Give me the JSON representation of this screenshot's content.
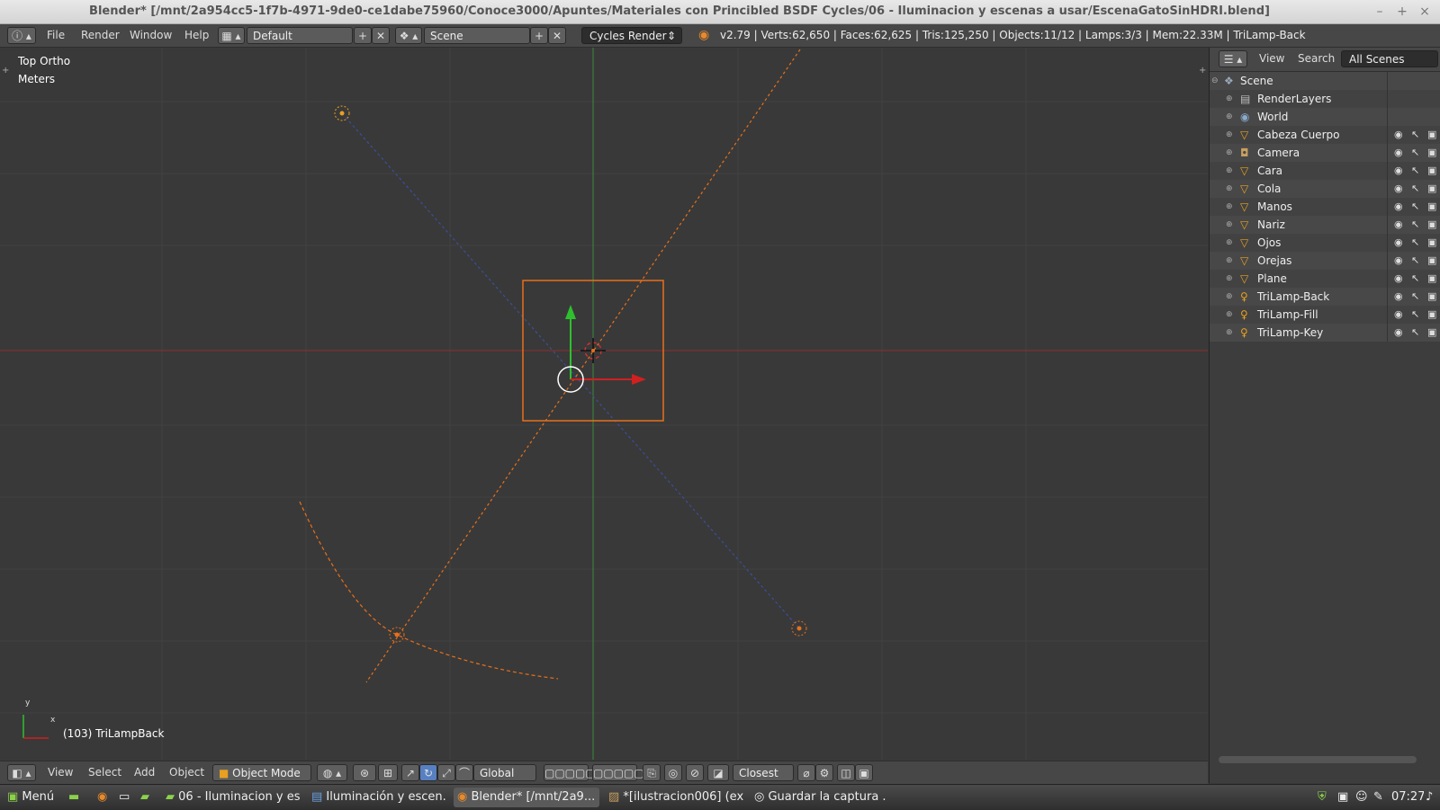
{
  "window": {
    "title": "Blender* [/mnt/2a954cc5-1f7b-4971-9de0-ce1dabe75960/Conoce3000/Apuntes/Materiales con Princibled BSDF Cycles/06 - Iluminacion y escenas a usar/EscenaGatoSinHDRI.blend]",
    "minimize": "–",
    "maximize": "+",
    "close": "×"
  },
  "infobar": {
    "menus": [
      "File",
      "Render",
      "Window",
      "Help"
    ],
    "layout": "Default",
    "scene": "Scene",
    "engine": "Cycles Render",
    "stats": "v2.79 | Verts:62,650 | Faces:62,625 | Tris:125,250 | Objects:11/12 | Lamps:3/3 | Mem:22.33M | TriLamp-Back"
  },
  "viewport": {
    "view_name": "Top Ortho",
    "units": "Meters",
    "active_object": "(103) TriLampBack",
    "axis_y": "y",
    "axis_x": "x"
  },
  "outliner": {
    "view_menu": "View",
    "search_menu": "Search",
    "display_mode": "All Scenes",
    "rows": [
      {
        "name": "Scene",
        "type": "scene"
      },
      {
        "name": "RenderLayers",
        "type": "renderlayers"
      },
      {
        "name": "World",
        "type": "world"
      },
      {
        "name": "Cabeza Cuerpo",
        "type": "mesh"
      },
      {
        "name": "Camera",
        "type": "camera"
      },
      {
        "name": "Cara",
        "type": "mesh"
      },
      {
        "name": "Cola",
        "type": "mesh"
      },
      {
        "name": "Manos",
        "type": "mesh"
      },
      {
        "name": "Nariz",
        "type": "mesh"
      },
      {
        "name": "Ojos",
        "type": "mesh"
      },
      {
        "name": "Orejas",
        "type": "mesh"
      },
      {
        "name": "Plane",
        "type": "mesh"
      },
      {
        "name": "TriLamp-Back",
        "type": "lamp"
      },
      {
        "name": "TriLamp-Fill",
        "type": "lamp"
      },
      {
        "name": "TriLamp-Key",
        "type": "lamp"
      }
    ]
  },
  "bottombar": {
    "menus": [
      "View",
      "Select",
      "Add",
      "Object"
    ],
    "mode": "Object Mode",
    "orientation": "Global",
    "snap": "Closest"
  },
  "taskbar": {
    "start": "Menú",
    "items": [
      "06 - Iluminacion y es...",
      "Iluminación y escen...",
      "Blender* [/mnt/2a9...",
      "*[ilustracion006] (ex...",
      "Guardar la captura ..."
    ],
    "clock": "07:27"
  },
  "colors": {
    "accent_orange": "#e88a2a",
    "axis_red": "#b03030",
    "axis_green": "#3a9a3a",
    "selection": "#e8701a"
  }
}
